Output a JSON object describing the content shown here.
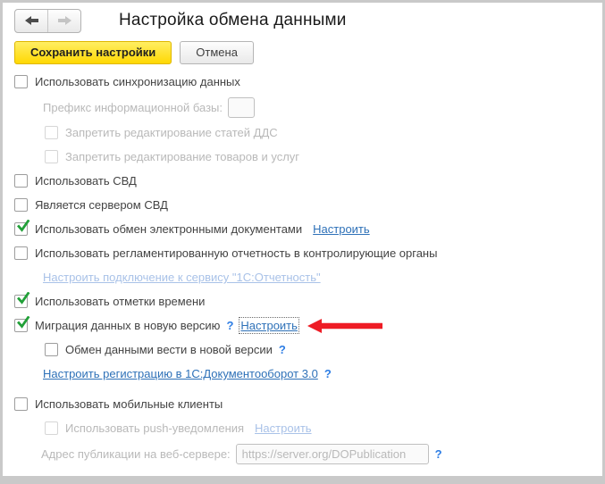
{
  "window": {
    "title": "Настройка обмена данными"
  },
  "nav": {
    "back_icon": "arrow-left",
    "forward_icon": "arrow-right",
    "forward_disabled": true
  },
  "toolbar": {
    "save_label": "Сохранить настройки",
    "cancel_label": "Отмена"
  },
  "rows": {
    "sync": {
      "label": "Использовать синхронизацию данных",
      "checked": false,
      "enabled": true
    },
    "prefix": {
      "label": "Префикс информационной базы:",
      "value": "",
      "enabled": false
    },
    "forbid_dds": {
      "label": "Запретить редактирование статей ДДС",
      "checked": false,
      "enabled": false
    },
    "forbid_goods": {
      "label": "Запретить редактирование товаров и услуг",
      "checked": false,
      "enabled": false
    },
    "svd": {
      "label": "Использовать СВД",
      "checked": false,
      "enabled": true
    },
    "svd_server": {
      "label": "Является сервером СВД",
      "checked": false,
      "enabled": true
    },
    "edi": {
      "label": "Использовать обмен электронными документами",
      "link": "Настроить",
      "checked": true,
      "enabled": true
    },
    "reports": {
      "label": "Использовать регламентированную отчетность в контролирующие органы",
      "checked": false,
      "enabled": true
    },
    "reports_link": {
      "label": "Настроить подключение к сервису \"1С:Отчетность\"",
      "enabled": false
    },
    "timestamps": {
      "label": "Использовать отметки времени",
      "checked": true,
      "enabled": true
    },
    "migration": {
      "label": "Миграция данных в новую версию",
      "help": "?",
      "link": "Настроить",
      "checked": true,
      "enabled": true,
      "link_focused": true
    },
    "new_version": {
      "label": "Обмен данными вести в новой версии",
      "help": "?",
      "checked": false,
      "enabled": true
    },
    "do3_link": {
      "label": "Настроить регистрацию в 1С:Документооборот 3.0",
      "help": "?",
      "enabled": true
    },
    "mobile": {
      "label": "Использовать мобильные клиенты",
      "checked": false,
      "enabled": true
    },
    "push": {
      "label": "Использовать push-уведомления",
      "link": "Настроить",
      "checked": false,
      "enabled": false
    },
    "address": {
      "label": "Адрес публикации на веб-сервере:",
      "placeholder": "https://server.org/DOPublication",
      "help": "?",
      "enabled": false
    }
  },
  "icons": {
    "back": "arrow-left",
    "forward": "arrow-right",
    "check": "green-checkmark",
    "annotation": "red-arrow-pointing-left",
    "help": "question-mark"
  },
  "colors": {
    "save_button_yellow": "#ffdf1b",
    "check_green": "#21a038",
    "link_blue": "#2e71b8",
    "disabled_link_blue": "#a9c2e8",
    "help_blue": "#2d7de4",
    "annotation_red": "#ee1c25",
    "border_gray": "#c9c9c9"
  }
}
